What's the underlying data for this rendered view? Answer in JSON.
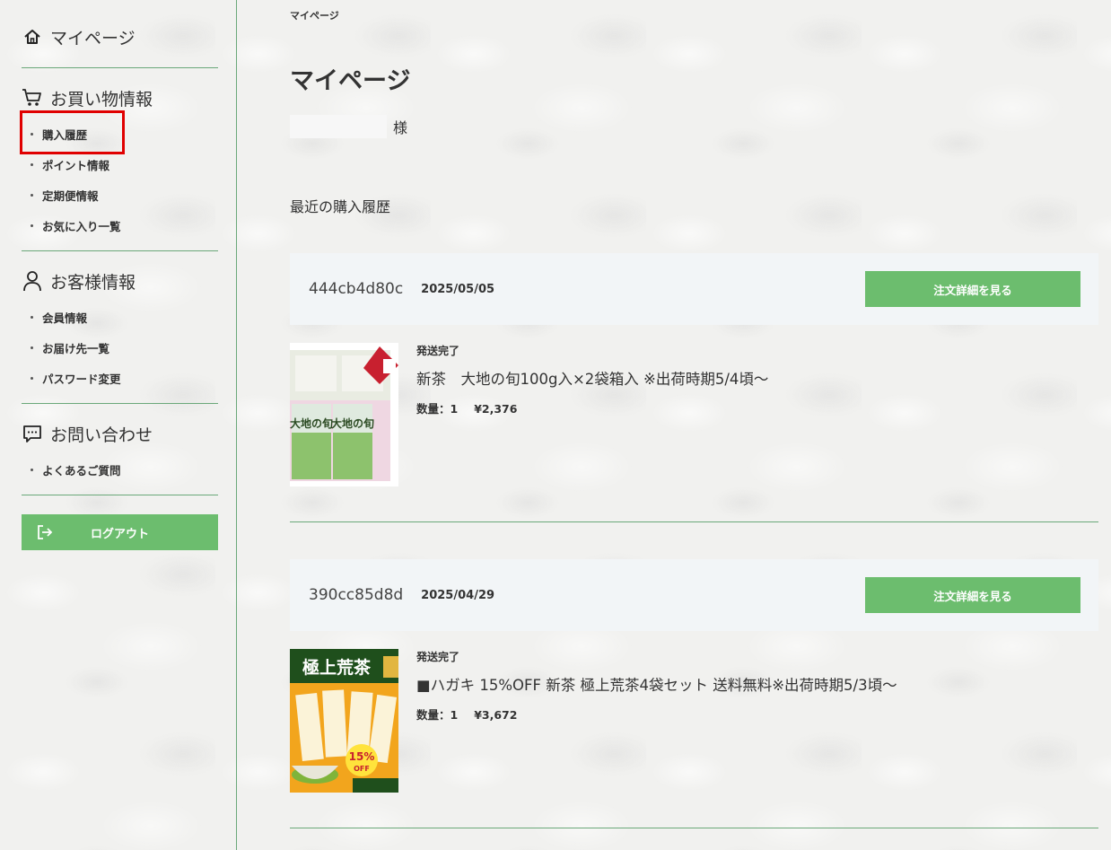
{
  "sidebar": {
    "mypage_label": "マイページ",
    "shopping": {
      "heading": "お買い物情報",
      "items": [
        "購入履歴",
        "ポイント情報",
        "定期便情報",
        "お気に入り一覧"
      ]
    },
    "customer": {
      "heading": "お客様情報",
      "items": [
        "会員情報",
        "お届け先一覧",
        "パスワード変更"
      ]
    },
    "contact": {
      "heading": "お問い合わせ",
      "items": [
        "よくあるご質問"
      ]
    },
    "logout_label": "ログアウト"
  },
  "main": {
    "breadcrumb": "マイページ",
    "title": "マイページ",
    "honorific": "様",
    "recent_heading": "最近の購入履歴",
    "detail_button_label": "注文詳細を見る",
    "orders": [
      {
        "id": "444cb4d80c",
        "date": "2025/05/05",
        "status": "発送完了",
        "product": "新茶　大地の旬100g入×2袋箱入 ※出荷時期5/4頃～",
        "quantity": "数量：1",
        "price": "¥2,376",
        "image_text": "大地の旬"
      },
      {
        "id": "390cc85d8d",
        "date": "2025/04/29",
        "status": "発送完了",
        "product": "■ハガキ 15%OFF 新茶 極上荒茶4袋セット 送料無料※出荷時期5/3頃～",
        "quantity": "数量：1",
        "price": "¥3,672",
        "image_banner": "極上荒茶",
        "image_badge": "15%",
        "image_badge_sub": "OFF"
      }
    ]
  },
  "colors": {
    "accent_green": "#6cbd6e",
    "divider_green": "#6aa879",
    "highlight_red": "#e00000"
  }
}
